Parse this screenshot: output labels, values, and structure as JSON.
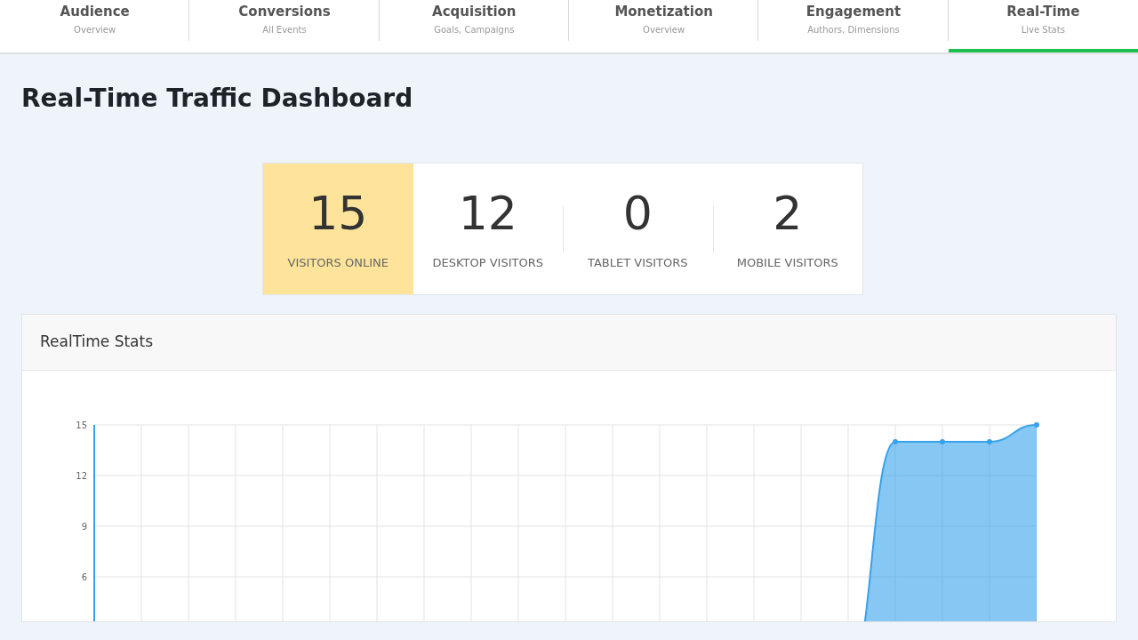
{
  "tabs": [
    {
      "label": "Audience",
      "sublabel": "Overview",
      "selected": false
    },
    {
      "label": "Conversions",
      "sublabel": "All Events",
      "selected": false
    },
    {
      "label": "Acquisition",
      "sublabel": "Goals, Campaigns",
      "selected": false
    },
    {
      "label": "Monetization",
      "sublabel": "Overview",
      "selected": false
    },
    {
      "label": "Engagement",
      "sublabel": "Authors, Dimensions",
      "selected": false
    },
    {
      "label": "Real-Time",
      "sublabel": "Live Stats",
      "selected": true
    }
  ],
  "title": "Real-Time Traffic Dashboard",
  "stats": [
    {
      "value": "15",
      "label": "VISITORS ONLINE",
      "highlighted": true
    },
    {
      "value": "12",
      "label": "DESKTOP VISITORS",
      "highlighted": false
    },
    {
      "value": "0",
      "label": "TABLET VISITORS",
      "highlighted": false
    },
    {
      "value": "2",
      "label": "MOBILE VISITORS",
      "highlighted": false
    }
  ],
  "panel": {
    "title": "RealTime Stats",
    "chart_data": {
      "type": "area",
      "grid": true,
      "series": [
        {
          "color": "#36a2eb",
          "values": [
            0,
            0,
            0,
            0,
            0,
            0,
            0,
            0,
            0,
            0,
            0,
            0,
            0,
            0,
            0,
            0,
            0,
            14,
            14,
            14,
            15
          ]
        }
      ],
      "ylim": [
        0,
        15
      ],
      "yticks": [
        6,
        9,
        12,
        15
      ]
    }
  }
}
